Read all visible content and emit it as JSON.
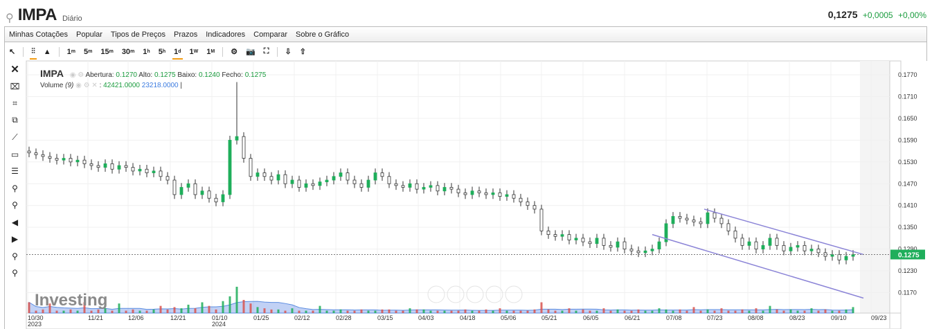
{
  "header": {
    "symbol": "IMPA",
    "period": "Diário",
    "last": "0,1275",
    "change": "+0,0005",
    "change_pct": "+0,00%"
  },
  "menu": [
    "Minhas Cotações",
    "Popular",
    "Tipos de Preços",
    "Prazos",
    "Indicadores",
    "Comparar",
    "Sobre o Gráfico"
  ],
  "toolbar": {
    "intervals": [
      {
        "n": "1",
        "u": "m"
      },
      {
        "n": "5",
        "u": "m"
      },
      {
        "n": "15",
        "u": "m"
      },
      {
        "n": "30",
        "u": "m"
      },
      {
        "n": "1",
        "u": "h"
      },
      {
        "n": "5",
        "u": "h"
      },
      {
        "n": "1",
        "u": "d"
      },
      {
        "n": "1",
        "u": "W"
      },
      {
        "n": "1",
        "u": "M"
      }
    ],
    "selected_interval": "1d"
  },
  "legend": {
    "symbol": "IMPA",
    "open_label": "Abertura:",
    "open": "0.1270",
    "high_label": "Alto:",
    "high": "0.1275",
    "low_label": "Baixo:",
    "low": "0.1240",
    "close_label": "Fecho:",
    "close": "0.1275",
    "volume_label": "Volume",
    "volume_period": "(9)",
    "volume_value": "42421.0000",
    "volume_ma": "23218.0000"
  },
  "watermark": {
    "brand": "Investing",
    ".com": ".com"
  },
  "colors": {
    "up": "#1fae5b",
    "down": "#d9534f",
    "price_tag": "#1fae5b",
    "trend": "#8b84d7"
  },
  "chart_data": {
    "type": "candlestick",
    "price_ticks": [
      "0.1770",
      "0.1710",
      "0.1650",
      "0.1590",
      "0.1530",
      "0.1470",
      "0.1410",
      "0.1350",
      "0.1290",
      "0.1230",
      "0.1170"
    ],
    "ylim": [
      0.1155,
      0.179
    ],
    "current_price": "0.1275",
    "date_ticks": [
      {
        "d": "10/30",
        "y": "2023",
        "i": 0
      },
      {
        "d": "11/21",
        "i": 8.7
      },
      {
        "d": "12/06",
        "i": 14.5
      },
      {
        "d": "12/21",
        "i": 20.6
      },
      {
        "d": "01/10",
        "y": "2024",
        "i": 26.6
      },
      {
        "d": "01/25",
        "i": 32.6
      },
      {
        "d": "02/12",
        "i": 38.5
      },
      {
        "d": "02/28",
        "i": 44.5
      },
      {
        "d": "03/15",
        "i": 50.5
      },
      {
        "d": "04/03",
        "i": 56.4
      },
      {
        "d": "04/18",
        "i": 62.4
      },
      {
        "d": "05/06",
        "i": 68.3
      },
      {
        "d": "05/21",
        "i": 74.2
      },
      {
        "d": "06/05",
        "i": 80.2
      },
      {
        "d": "06/21",
        "i": 86.2
      },
      {
        "d": "07/08",
        "i": 92.2
      },
      {
        "d": "07/23",
        "i": 98.1
      },
      {
        "d": "08/08",
        "i": 104
      },
      {
        "d": "08/23",
        "i": 110
      },
      {
        "d": "09/10",
        "i": 116
      },
      {
        "d": "09/23",
        "i": 121.8
      }
    ],
    "closes": [
      0.1555,
      0.155,
      0.1545,
      0.154,
      0.1535,
      0.154,
      0.153,
      0.1535,
      0.1525,
      0.152,
      0.1515,
      0.1525,
      0.151,
      0.152,
      0.1515,
      0.1505,
      0.151,
      0.15,
      0.1505,
      0.149,
      0.148,
      0.144,
      0.146,
      0.147,
      0.144,
      0.145,
      0.143,
      0.142,
      0.144,
      0.159,
      0.16,
      0.154,
      0.149,
      0.15,
      0.149,
      0.148,
      0.1495,
      0.147,
      0.148,
      0.146,
      0.147,
      0.1465,
      0.1475,
      0.148,
      0.149,
      0.15,
      0.148,
      0.147,
      0.146,
      0.148,
      0.15,
      0.149,
      0.147,
      0.1465,
      0.146,
      0.147,
      0.1455,
      0.146,
      0.1465,
      0.145,
      0.146,
      0.1455,
      0.1445,
      0.144,
      0.145,
      0.1445,
      0.144,
      0.1445,
      0.1435,
      0.144,
      0.143,
      0.142,
      0.141,
      0.14,
      0.134,
      0.133,
      0.1325,
      0.133,
      0.1315,
      0.132,
      0.131,
      0.1305,
      0.132,
      0.13,
      0.1295,
      0.131,
      0.129,
      0.1285,
      0.128,
      0.1285,
      0.129,
      0.131,
      0.136,
      0.138,
      0.1375,
      0.137,
      0.1365,
      0.136,
      0.139,
      0.1375,
      0.136,
      0.134,
      0.132,
      0.13,
      0.131,
      0.129,
      0.13,
      0.132,
      0.13,
      0.1285,
      0.1295,
      0.13,
      0.1285,
      0.129,
      0.128,
      0.127,
      0.1275,
      0.126,
      0.127,
      0.1275
    ],
    "high_spike": {
      "i": 30,
      "price": 0.175
    },
    "volumes": [
      9,
      2,
      3,
      8,
      2,
      2,
      3,
      2,
      9,
      2,
      3,
      4,
      2,
      8,
      2,
      3,
      2,
      2,
      3,
      6,
      3,
      5,
      4,
      7,
      4,
      9,
      6,
      3,
      10,
      14,
      22,
      11,
      8,
      5,
      4,
      3,
      3,
      2,
      4,
      2,
      2,
      2,
      6,
      2,
      2,
      3,
      2,
      2,
      3,
      2,
      2,
      3,
      3,
      2,
      2,
      4,
      3,
      3,
      2,
      2,
      2,
      2,
      2,
      3,
      2,
      2,
      3,
      2,
      4,
      2,
      2,
      2,
      2,
      3,
      9,
      3,
      2,
      2,
      4,
      2,
      3,
      2,
      2,
      4,
      2,
      3,
      2,
      2,
      3,
      2,
      2,
      4,
      3,
      2,
      3,
      2,
      5,
      2,
      3,
      2,
      4,
      2,
      2,
      3,
      2,
      4,
      2,
      6,
      3,
      2,
      3,
      2,
      2,
      4,
      2,
      3,
      2,
      2,
      3,
      5
    ],
    "trendlines": [
      {
        "from": {
          "i": 97.5,
          "price": 0.14
        },
        "to": {
          "i": 120.5,
          "price": 0.1275
        }
      },
      {
        "from": {
          "i": 90,
          "price": 0.133
        },
        "to": {
          "i": 120.5,
          "price": 0.1155
        }
      }
    ]
  }
}
